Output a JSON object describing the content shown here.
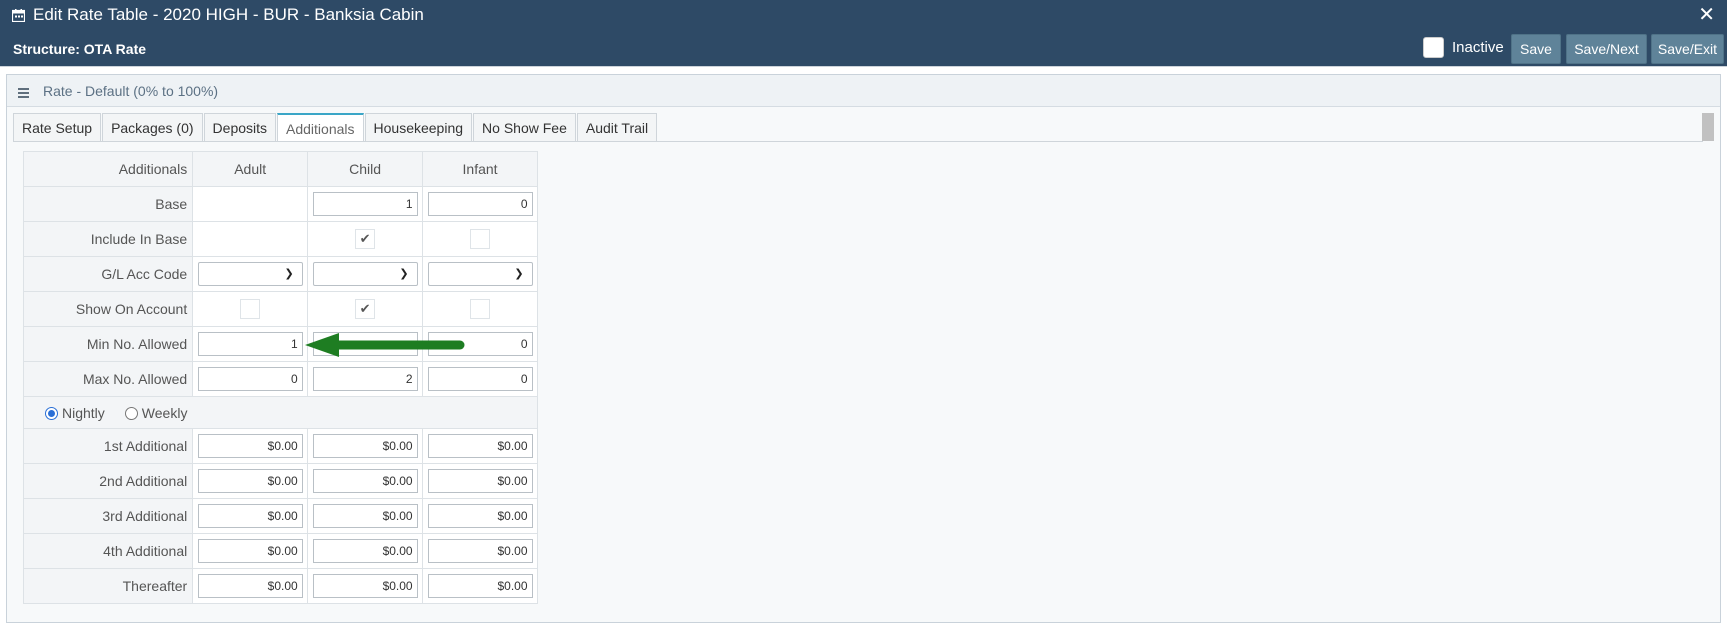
{
  "header": {
    "title": "Edit Rate Table - 2020 HIGH - BUR - Banksia Cabin",
    "structure": "Structure: OTA Rate",
    "inactive_label": "Inactive",
    "buttons": {
      "save": "Save",
      "save_next": "Save/Next",
      "save_exit": "Save/Exit"
    },
    "close": "✕"
  },
  "panel": {
    "title": "Rate - Default (0% to 100%)",
    "tabs": [
      "Rate Setup",
      "Packages (0)",
      "Deposits",
      "Additionals",
      "Housekeeping",
      "No Show Fee",
      "Audit Trail"
    ],
    "active_tab": "Additionals"
  },
  "grid": {
    "headers": [
      "Additionals",
      "Adult",
      "Child",
      "Infant"
    ],
    "base_label": "Base",
    "base_values": [
      "",
      "1",
      "0"
    ],
    "include_label": "Include In Base",
    "include_checked": [
      false,
      true,
      false
    ],
    "gl_label": "G/L Acc Code",
    "show_label": "Show On Account",
    "show_checked": [
      false,
      true,
      false
    ],
    "min_label": "Min No. Allowed",
    "min_values": [
      "1",
      "",
      "0"
    ],
    "max_label": "Max No. Allowed",
    "max_values": [
      "0",
      "2",
      "0"
    ],
    "radio_nightly": "Nightly",
    "radio_weekly": "Weekly",
    "selected_period": "Nightly",
    "additional_rows": [
      {
        "label": "1st Additional",
        "values": [
          "$0.00",
          "$0.00",
          "$0.00"
        ]
      },
      {
        "label": "2nd Additional",
        "values": [
          "$0.00",
          "$0.00",
          "$0.00"
        ]
      },
      {
        "label": "3rd Additional",
        "values": [
          "$0.00",
          "$0.00",
          "$0.00"
        ]
      },
      {
        "label": "4th Additional",
        "values": [
          "$0.00",
          "$0.00",
          "$0.00"
        ]
      },
      {
        "label": "Thereafter",
        "values": [
          "$0.00",
          "$0.00",
          "$0.00"
        ]
      }
    ]
  },
  "colors": {
    "header_bg": "#2e4a66",
    "button_bg": "#5f8399",
    "arrow": "#1e7d22",
    "active_tab_accent": "#3aa6c7"
  }
}
